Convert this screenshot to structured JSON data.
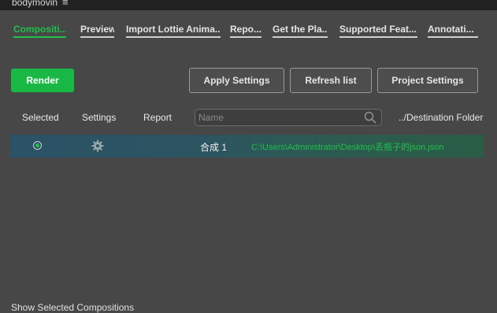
{
  "app": {
    "title": "bodymovin",
    "menu_icon": "hamburger-icon"
  },
  "tabs": [
    {
      "label": "Compositi...",
      "active": true
    },
    {
      "label": "Preview"
    },
    {
      "label": "Import Lottie Anima..."
    },
    {
      "label": "Repo..."
    },
    {
      "label": "Get the Pla..."
    },
    {
      "label": "Supported Feat..."
    },
    {
      "label": "Annotati..."
    }
  ],
  "buttons": {
    "render": "Render",
    "apply_settings": "Apply Settings",
    "refresh_list": "Refresh list",
    "project_settings": "Project Settings"
  },
  "columns": {
    "selected": "Selected",
    "settings": "Settings",
    "report": "Report",
    "destination": "../Destination Folder"
  },
  "search": {
    "placeholder": "Name",
    "icon": "search-icon"
  },
  "compositions": [
    {
      "selected": true,
      "name": "合成 1",
      "destination": "C:\\Users\\Administrator\\Desktop\\丢瓶子的json.json"
    }
  ],
  "footer": {
    "label": "Show Selected Compositions"
  },
  "colors": {
    "accent": "#1ec24a",
    "background": "#474747",
    "titlebar": "#222222"
  }
}
